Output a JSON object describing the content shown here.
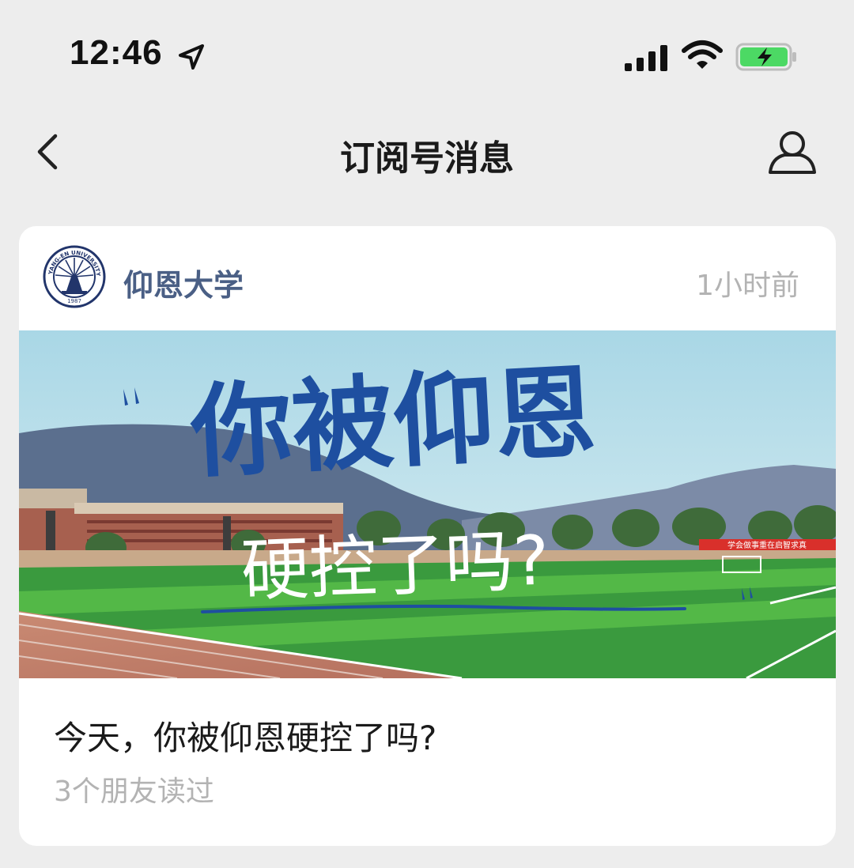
{
  "status_bar": {
    "time": "12:46",
    "icons": [
      "location-arrow-icon",
      "signal-icon",
      "wifi-icon",
      "battery-charging-icon"
    ],
    "battery_color": "#4cd964"
  },
  "nav": {
    "title": "订阅号消息",
    "back_icon": "chevron-left-icon",
    "profile_icon": "person-icon"
  },
  "card": {
    "account_name": "仰恩大学",
    "avatar_text_top": "YANG-EN UNIVERSITY",
    "avatar_year": "1987",
    "time_ago": "1小时前",
    "cover": {
      "headline_1": "你被仰恩",
      "headline_2": "硬控了吗?",
      "banner_text": "学会做事重在启智求真",
      "headline_color": "#1e4fa0"
    },
    "article_title": "今天，你被仰恩硬控了吗?",
    "read_count": "3个朋友读过",
    "account_name_color": "#4a5f85"
  }
}
